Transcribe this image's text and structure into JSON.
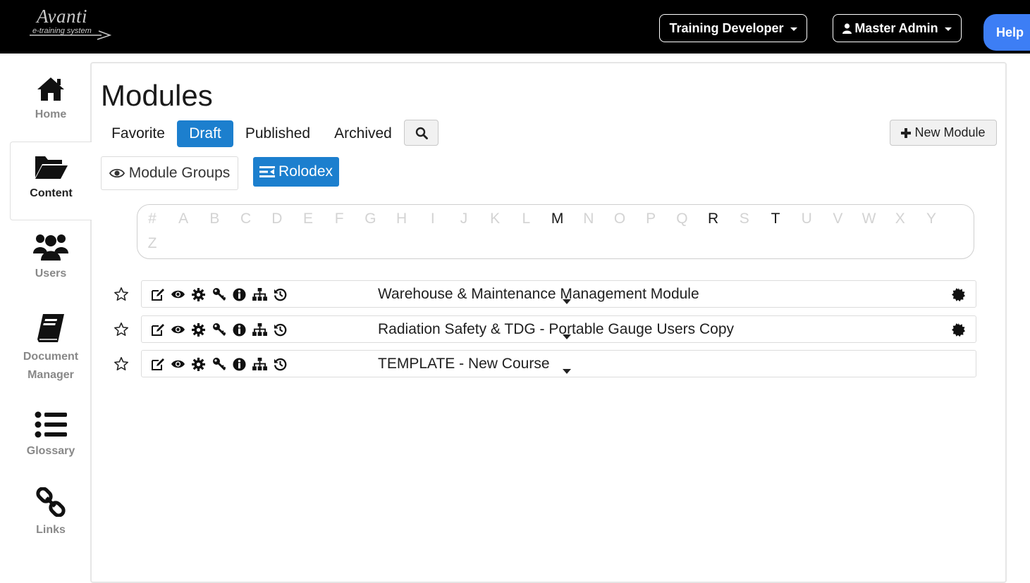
{
  "header": {
    "logo_name": "Avanti",
    "logo_tagline": "e-training system",
    "role_button": "Training Developer",
    "user_button": "Master Admin",
    "help_button": "Help"
  },
  "sidebar": {
    "items": [
      {
        "label": "Home",
        "icon": "home-icon"
      },
      {
        "label": "Content",
        "icon": "folder-open-icon",
        "active": true
      },
      {
        "label": "Users",
        "icon": "users-icon"
      },
      {
        "label": "Document Manager",
        "icon": "book-icon"
      },
      {
        "label": "Glossary",
        "icon": "list-icon"
      },
      {
        "label": "Links",
        "icon": "link-icon"
      }
    ]
  },
  "main": {
    "title": "Modules",
    "tabs": [
      {
        "label": "Favorite"
      },
      {
        "label": "Draft",
        "active": true
      },
      {
        "label": "Published"
      },
      {
        "label": "Archived"
      }
    ],
    "new_module_label": "New Module",
    "module_groups_label": "Module Groups",
    "rolodex_label": "Rolodex",
    "alphabet": [
      {
        "letter": "#",
        "enabled": false
      },
      {
        "letter": "A",
        "enabled": false
      },
      {
        "letter": "B",
        "enabled": false
      },
      {
        "letter": "C",
        "enabled": false
      },
      {
        "letter": "D",
        "enabled": false
      },
      {
        "letter": "E",
        "enabled": false
      },
      {
        "letter": "F",
        "enabled": false
      },
      {
        "letter": "G",
        "enabled": false
      },
      {
        "letter": "H",
        "enabled": false
      },
      {
        "letter": "I",
        "enabled": false
      },
      {
        "letter": "J",
        "enabled": false
      },
      {
        "letter": "K",
        "enabled": false
      },
      {
        "letter": "L",
        "enabled": false
      },
      {
        "letter": "M",
        "enabled": true
      },
      {
        "letter": "N",
        "enabled": false
      },
      {
        "letter": "O",
        "enabled": false
      },
      {
        "letter": "P",
        "enabled": false
      },
      {
        "letter": "Q",
        "enabled": false
      },
      {
        "letter": "R",
        "enabled": true
      },
      {
        "letter": "S",
        "enabled": false
      },
      {
        "letter": "T",
        "enabled": true
      },
      {
        "letter": "U",
        "enabled": false
      },
      {
        "letter": "V",
        "enabled": false
      },
      {
        "letter": "W",
        "enabled": false
      },
      {
        "letter": "X",
        "enabled": false
      },
      {
        "letter": "Y",
        "enabled": false
      },
      {
        "letter": "Z",
        "enabled": false
      }
    ],
    "modules": [
      {
        "title": "Warehouse & Maintenance Management Module",
        "badge": true
      },
      {
        "title": "Radiation Safety & TDG - Portable Gauge Users Copy",
        "badge": true
      },
      {
        "title": "TEMPLATE - New Course",
        "badge": false
      }
    ],
    "row_icons": [
      "edit-icon",
      "eye-icon",
      "gear-icon",
      "key-icon",
      "info-icon",
      "sitemap-icon",
      "history-icon"
    ]
  },
  "colors": {
    "primary": "#1c7fce",
    "help": "#3d7ef5",
    "topbar": "#000000"
  }
}
